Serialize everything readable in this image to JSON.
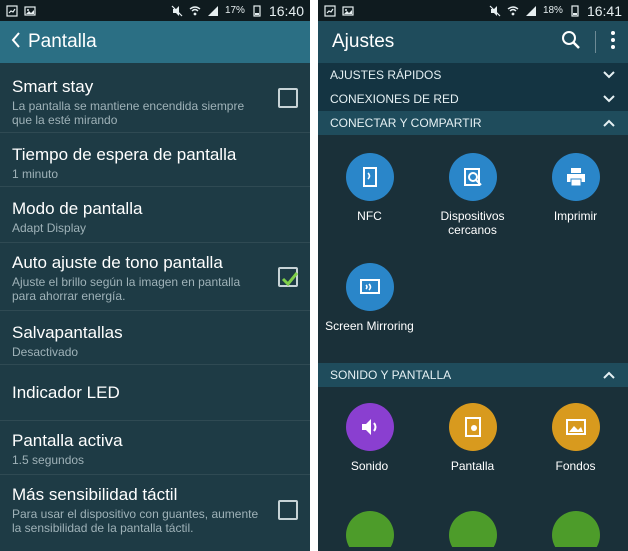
{
  "left": {
    "status": {
      "time": "16:40",
      "battery": "17%"
    },
    "appbar": {
      "title": "Pantalla"
    },
    "items": [
      {
        "title": "Smart stay",
        "subtitle": "La pantalla se mantiene encendida siempre que la esté mirando",
        "checkbox": "unchecked"
      },
      {
        "title": "Tiempo de espera de pantalla",
        "subtitle": "1 minuto",
        "checkbox": "none"
      },
      {
        "title": "Modo de pantalla",
        "subtitle": "Adapt Display",
        "checkbox": "none"
      },
      {
        "title": "Auto ajuste de tono pantalla",
        "subtitle": "Ajuste el brillo según la imagen en pantalla para ahorrar energía.",
        "checkbox": "checked"
      },
      {
        "title": "Salvapantallas",
        "subtitle": "Desactivado",
        "checkbox": "none"
      },
      {
        "title": "Indicador LED",
        "subtitle": "",
        "checkbox": "none"
      },
      {
        "title": "Pantalla activa",
        "subtitle": "1.5 segundos",
        "checkbox": "none"
      },
      {
        "title": "Más sensibilidad táctil",
        "subtitle": "Para usar el dispositivo con guantes, aumente la sensibilidad de la pantalla táctil.",
        "checkbox": "unchecked"
      }
    ]
  },
  "right": {
    "status": {
      "time": "16:41",
      "battery": "18%"
    },
    "appbar": {
      "title": "Ajustes"
    },
    "sections": {
      "quick": "AJUSTES RÁPIDOS",
      "network": "CONEXIONES DE RED",
      "connect": "CONECTAR Y COMPARTIR",
      "sound": "SONIDO Y PANTALLA"
    },
    "connect_tiles": [
      {
        "label": "NFC",
        "icon": "nfc-icon",
        "color": "#2a86c9"
      },
      {
        "label": "Dispositivos cercanos",
        "icon": "nearby-devices-icon",
        "color": "#2a86c9"
      },
      {
        "label": "Imprimir",
        "icon": "printer-icon",
        "color": "#2a86c9"
      },
      {
        "label": "Screen Mirroring",
        "icon": "screen-mirroring-icon",
        "color": "#2a86c9"
      }
    ],
    "sound_tiles": [
      {
        "label": "Sonido",
        "icon": "speaker-icon",
        "color": "#8a3fd0"
      },
      {
        "label": "Pantalla",
        "icon": "display-icon",
        "color": "#d89a1e"
      },
      {
        "label": "Fondos",
        "icon": "wallpaper-icon",
        "color": "#d89a1e"
      }
    ],
    "more_tiles_colors": [
      "#4d9c2a",
      "#4d9c2a",
      "#4d9c2a"
    ]
  },
  "colors": {
    "accent": "#2b6f84",
    "check": "#7fd04a"
  }
}
